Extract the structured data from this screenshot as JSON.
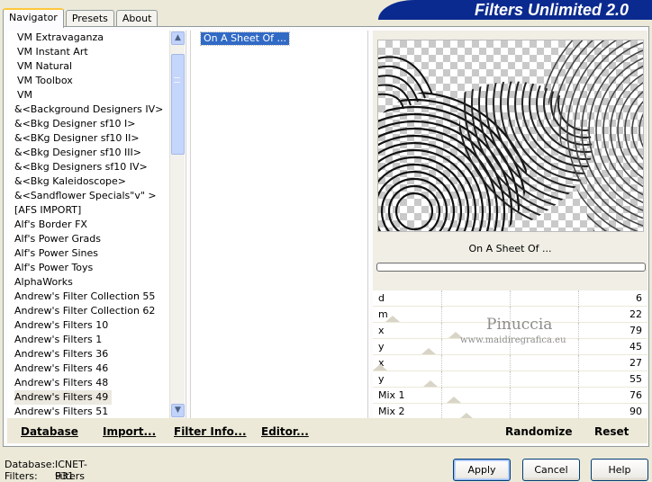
{
  "title": "Filters Unlimited 2.0",
  "tabs": [
    {
      "label": "Navigator"
    },
    {
      "label": "Presets"
    },
    {
      "label": "About"
    }
  ],
  "filter_list": [
    "VM Extravaganza",
    "VM Instant Art",
    "VM Natural",
    "VM Toolbox",
    "VM",
    "&<Background Designers IV>",
    "&<Bkg Designer sf10 I>",
    "&<BKg Designer sf10 II>",
    "&<Bkg Designer sf10 III>",
    "&<Bkg Designers sf10 IV>",
    "&<Bkg Kaleidoscope>",
    "&<Sandflower Specials\"v\" >",
    "[AFS IMPORT]",
    "Alf's Border FX",
    "Alf's Power Grads",
    "Alf's Power Sines",
    "Alf's Power Toys",
    "AlphaWorks",
    "Andrew's Filter Collection 55",
    "Andrew's Filter Collection 62",
    "Andrew's Filters 10",
    "Andrew's Filters 1",
    "Andrew's Filters 36",
    "Andrew's Filters 46",
    "Andrew's Filters 48",
    "Andrew's Filters 49",
    "Andrew's Filters 51"
  ],
  "selected_category": "Andrew's Filters 49",
  "selected_filter": "On A Sheet Of ...",
  "preview_filter_name": "On A Sheet Of ...",
  "progress_fraction": 0,
  "parameters": [
    {
      "label": "d",
      "value": "6"
    },
    {
      "label": "m",
      "value": "22"
    },
    {
      "label": "x",
      "value": "79"
    },
    {
      "label": "y",
      "value": "45"
    },
    {
      "label": "x",
      "value": "27"
    },
    {
      "label": "y",
      "value": "55"
    },
    {
      "label": "Mix 1",
      "value": "76"
    },
    {
      "label": "Mix 2",
      "value": "90"
    }
  ],
  "watermark": {
    "name": "Pinuccia",
    "site": "www.maidiregrafica.eu"
  },
  "bottom_actions": {
    "database": "Database",
    "import": "Import...",
    "filter_info": "Filter Info...",
    "editor": "Editor...",
    "randomize": "Randomize",
    "reset": "Reset"
  },
  "status": {
    "database_label": "Database:",
    "database_value": "ICNET-Filters",
    "filters_label": "Filters:",
    "filters_value": "931"
  },
  "buttons": {
    "apply": "Apply",
    "cancel": "Cancel",
    "help": "Help"
  },
  "colors": {
    "banner": "#0b2a8f",
    "selection": "#316ac5",
    "active_tab": "#ffc83c"
  }
}
